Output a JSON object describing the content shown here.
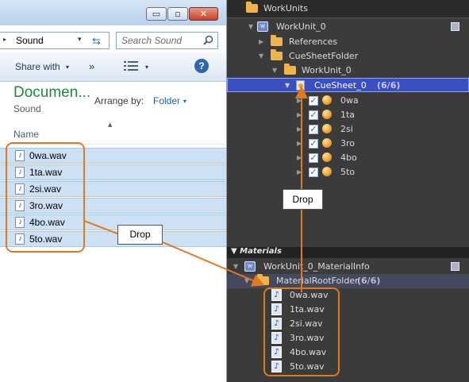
{
  "explorer": {
    "window_controls": {
      "minimize": "▭",
      "maximize": "▫",
      "close": "✕"
    },
    "address": {
      "arrow": "▸",
      "path": "Sound",
      "dropdown_icon": "▾"
    },
    "search": {
      "placeholder": "Search Sound",
      "icon": "search-icon"
    },
    "toolbar": {
      "share_label": "Share with",
      "more": "»",
      "caret": "▾",
      "help": "?"
    },
    "library": {
      "title": "Documen...",
      "subtitle": "Sound",
      "arrange_label": "Arrange by:",
      "arrange_value": "Folder",
      "arrange_caret": "▾"
    },
    "columns": {
      "name": "Name",
      "sort_caret": "▲"
    },
    "files": [
      {
        "name": "0wa.wav",
        "icon": "♪"
      },
      {
        "name": "1ta.wav",
        "icon": "♪"
      },
      {
        "name": "2si.wav",
        "icon": "♪"
      },
      {
        "name": "3ro.wav",
        "icon": "♪"
      },
      {
        "name": "4bo.wav",
        "icon": "♪"
      },
      {
        "name": "5to.wav",
        "icon": "♪"
      }
    ]
  },
  "cri": {
    "workunits_label": "WorkUnits",
    "workunit": "WorkUnit_0",
    "references": "References",
    "cuesheet_folder": "CueSheetFolder",
    "workunit_folder": "WorkUnit_0",
    "cuesheet": {
      "name": "CueSheet_0",
      "count": "(6/6)"
    },
    "cues": [
      "0wa",
      "1ta",
      "2si",
      "3ro",
      "4bo",
      "5to"
    ],
    "check": "✓",
    "materials": {
      "header": "▼ Materials",
      "workunit_info": "WorkUnit_0_MaterialInfo",
      "root_folder": {
        "name": "MaterialRootFolder",
        "count": "(6/6)"
      },
      "files": [
        "0wa.wav",
        "1ta.wav",
        "2si.wav",
        "3ro.wav",
        "4bo.wav",
        "5to.wav"
      ],
      "icon_glyph": "♪"
    }
  },
  "annotations": {
    "drop_left": "Drop",
    "drop_right": "Drop",
    "accent_color": "#e07a1f"
  }
}
